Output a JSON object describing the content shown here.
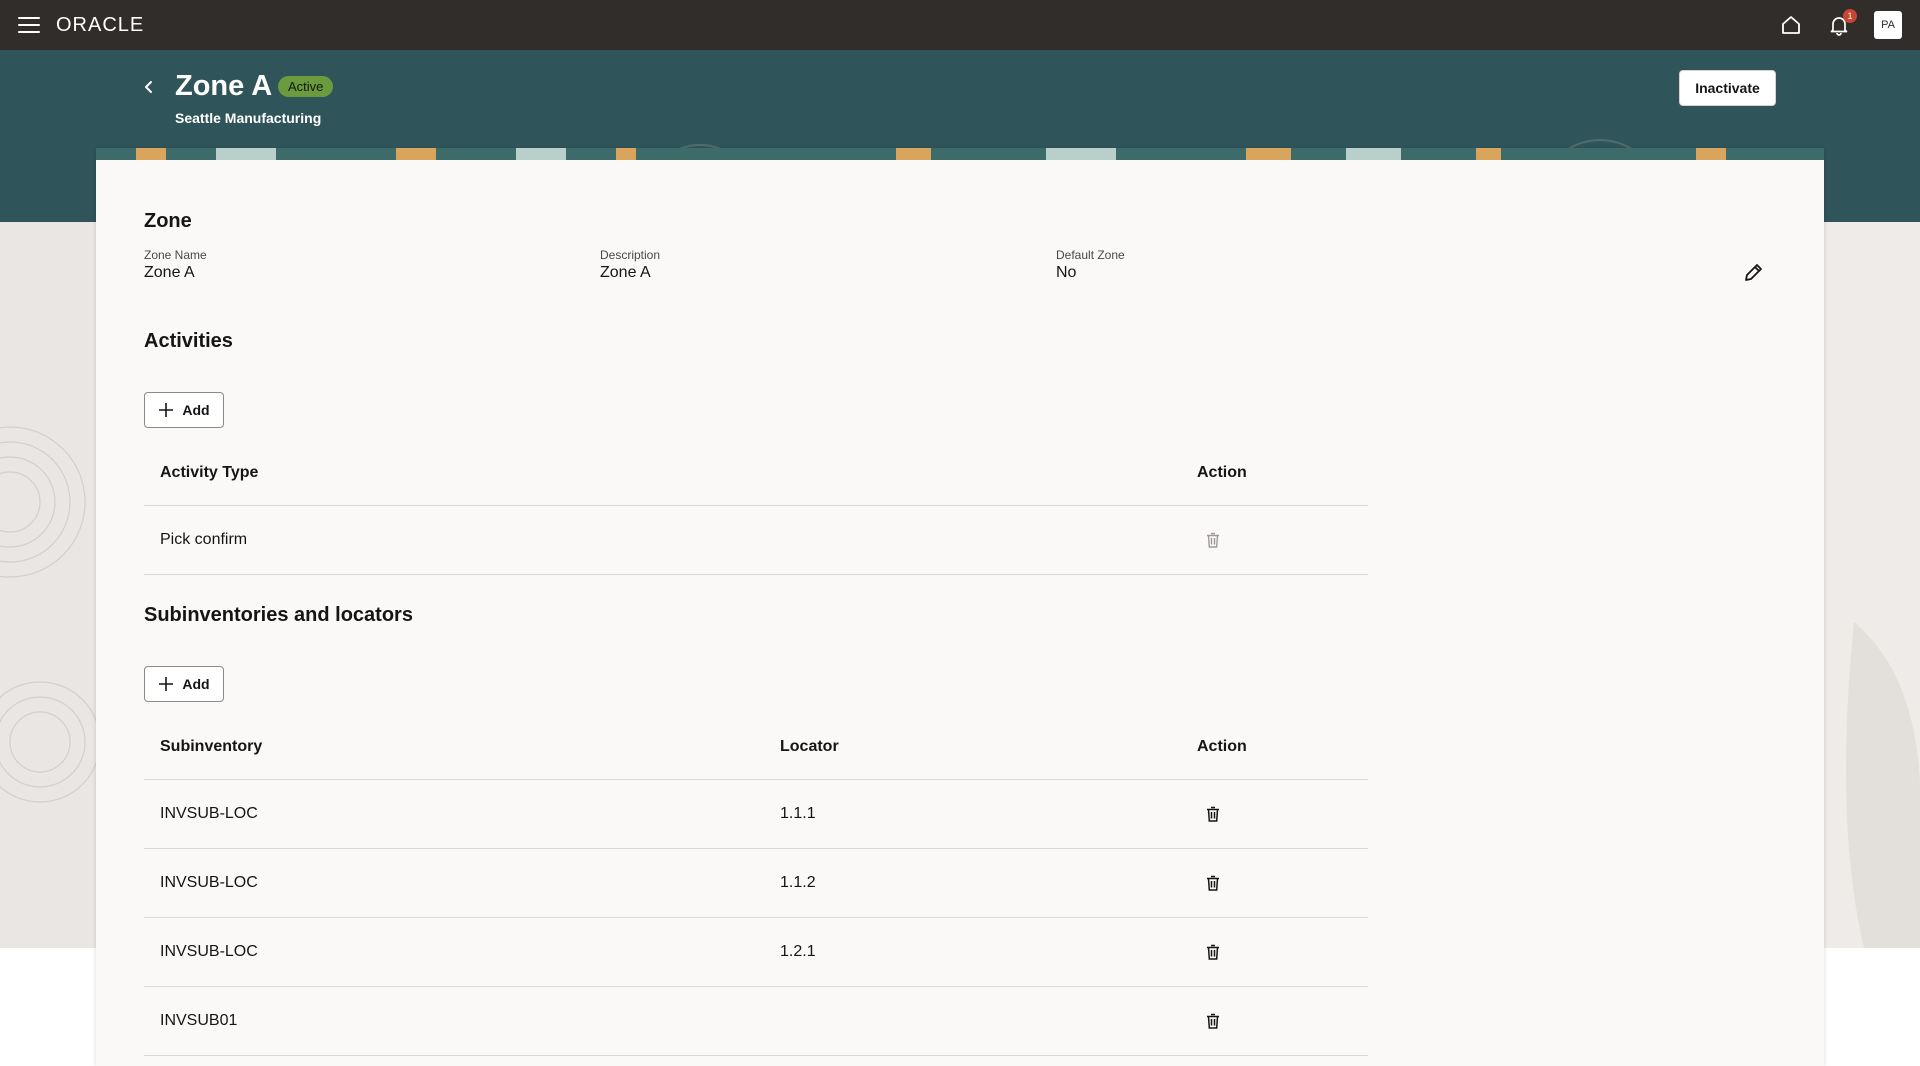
{
  "topbar": {
    "brand": "ORACLE",
    "notification_count": "1",
    "avatar_initials": "PA"
  },
  "header": {
    "title": "Zone A",
    "status": "Active",
    "subtitle": "Seattle Manufacturing",
    "inactivate_label": "Inactivate"
  },
  "zone": {
    "section_title": "Zone",
    "fields": [
      {
        "label": "Zone Name",
        "value": "Zone A"
      },
      {
        "label": "Description",
        "value": "Zone A"
      },
      {
        "label": "Default Zone",
        "value": "No"
      }
    ]
  },
  "activities": {
    "section_title": "Activities",
    "add_label": "Add",
    "columns": [
      "Activity Type",
      "Action"
    ],
    "rows": [
      {
        "activity_type": "Pick confirm"
      }
    ]
  },
  "subinventories": {
    "section_title": "Subinventories and locators",
    "add_label": "Add",
    "columns": [
      "Subinventory",
      "Locator",
      "Action"
    ],
    "rows": [
      {
        "subinventory": "INVSUB-LOC",
        "locator": "1.1.1"
      },
      {
        "subinventory": "INVSUB-LOC",
        "locator": "1.1.2"
      },
      {
        "subinventory": "INVSUB-LOC",
        "locator": "1.2.1"
      },
      {
        "subinventory": "INVSUB01",
        "locator": ""
      }
    ]
  },
  "colors": {
    "topbar": "#312d2a",
    "header_band": "#2f5459",
    "status_badge": "#6c9a3f",
    "notification_badge": "#c74634"
  }
}
